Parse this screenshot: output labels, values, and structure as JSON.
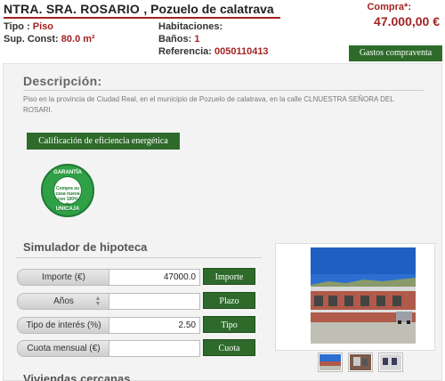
{
  "header": {
    "title": "NTRA. SRA. ROSARIO",
    "location": ", Pozuelo de calatrava",
    "tipo_label": "Tipo :",
    "tipo_value": "Piso",
    "sup_label": "Sup. Const:",
    "sup_value": "80.0 m²",
    "hab_label": "Habitaciones:",
    "hab_value": "",
    "banos_label": "Baños:",
    "banos_value": "1",
    "ref_label": "Referencia:",
    "ref_value": "0050110413",
    "price_label": "Compra*:",
    "price_value": "47.000,00 €",
    "gastos_button": "Gastos compraventa"
  },
  "description": {
    "title": "Descripción:",
    "text": "Piso en la provincia de Ciudad Real, en el municipio de Pozuelo de calatrava, en la calle CLNUESTRA SEÑORA DEL ROSARI."
  },
  "energy_button": "Calificación de eficiencia energética",
  "seal": {
    "top": "GARANTÍA",
    "middle": "Compra su casa nueva con 100% de financiación",
    "bottom": "UNICAJA"
  },
  "simulator": {
    "title": "Simulador de hipoteca",
    "rows": [
      {
        "label": "Importe (€)",
        "value": "47000.0",
        "button": "Importe"
      },
      {
        "label": "Años",
        "value": "",
        "button": "Plazo"
      },
      {
        "label": "Tipo de interés (%)",
        "value": "2.50",
        "button": "Tipo"
      },
      {
        "label": "Cuota mensual (€)",
        "value": "",
        "button": "Cuota"
      }
    ]
  },
  "next_section_title": "Viviendas cercanas",
  "colors": {
    "accent_red": "#a32323",
    "button_green": "#2e6b2b",
    "seal_green": "#2fa046"
  }
}
